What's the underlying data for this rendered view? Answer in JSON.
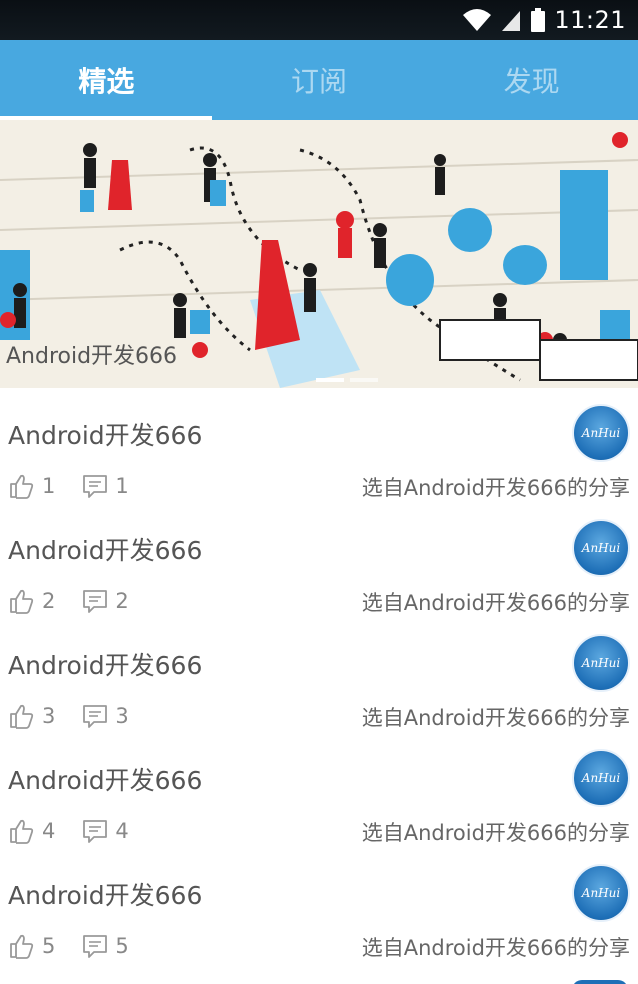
{
  "status": {
    "time": "11:21"
  },
  "tabs": [
    {
      "label": "精选",
      "active": true
    },
    {
      "label": "订阅",
      "active": false
    },
    {
      "label": "发现",
      "active": false
    }
  ],
  "banner": {
    "caption": "Android开发666"
  },
  "feed": [
    {
      "title": "Android开发666",
      "likes": "1",
      "comments": "1",
      "source": "选自Android开发666的分享"
    },
    {
      "title": "Android开发666",
      "likes": "2",
      "comments": "2",
      "source": "选自Android开发666的分享"
    },
    {
      "title": "Android开发666",
      "likes": "3",
      "comments": "3",
      "source": "选自Android开发666的分享"
    },
    {
      "title": "Android开发666",
      "likes": "4",
      "comments": "4",
      "source": "选自Android开发666的分享"
    },
    {
      "title": "Android开发666",
      "likes": "5",
      "comments": "5",
      "source": "选自Android开发666的分享"
    }
  ],
  "avatar": {
    "text": "AnHui"
  },
  "colors": {
    "accent": "#48a8e0",
    "text": "#555555",
    "avatar": "#1e6fb7"
  },
  "icons": {
    "like": "thumbs-up-icon",
    "comment": "comment-icon"
  }
}
